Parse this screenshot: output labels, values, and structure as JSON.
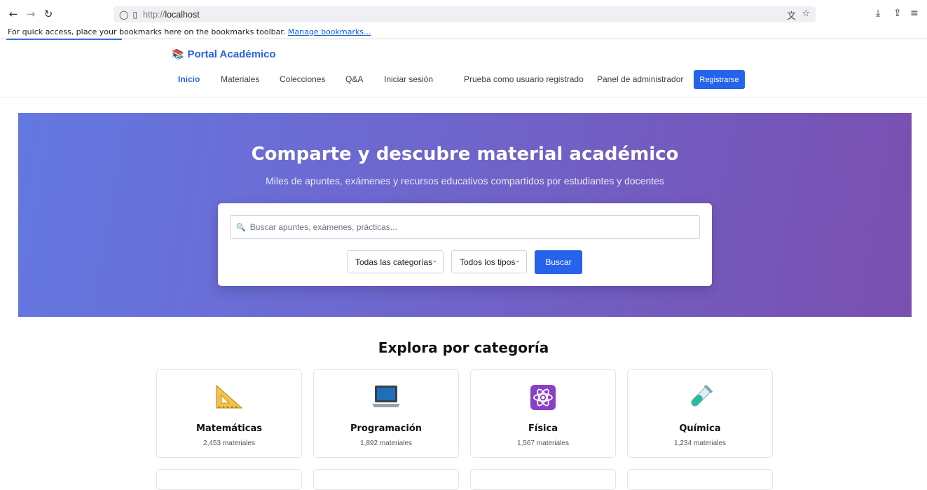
{
  "browser": {
    "url_prefix": "http://",
    "url_host": "localhost",
    "bookmarks_text": "For quick access, place your bookmarks here on the bookmarks toolbar.",
    "bookmarks_link": "Manage bookmarks..."
  },
  "header": {
    "logo_text": "Portal Académico",
    "nav": [
      {
        "label": "Inicio",
        "active": true
      },
      {
        "label": "Materiales"
      },
      {
        "label": "Colecciones"
      },
      {
        "label": "Q&A"
      },
      {
        "label": "Iniciar sesión"
      },
      {
        "label": "Prueba como usuario registrado"
      },
      {
        "label": "Panel de administrador"
      }
    ],
    "register_label": "Registrarse"
  },
  "hero": {
    "title": "Comparte y descubre material académico",
    "subtitle": "Miles de apuntes, exámenes y recursos educativos compartidos por estudiantes y docentes",
    "search_placeholder": "Buscar apuntes, exámenes, prácticas...",
    "category_select": "Todas las categorías",
    "type_select": "Todos los tipos",
    "search_button": "Buscar"
  },
  "categories": {
    "title": "Explora por categoría",
    "items": [
      {
        "name": "Matemáticas",
        "count": "2,453 materiales",
        "icon": "triangular-ruler-icon"
      },
      {
        "name": "Programación",
        "count": "1,892 materiales",
        "icon": "laptop-icon"
      },
      {
        "name": "Física",
        "count": "1,567 materiales",
        "icon": "atom-icon"
      },
      {
        "name": "Química",
        "count": "1,234 materiales",
        "icon": "test-tube-icon"
      }
    ]
  },
  "colors": {
    "accent": "#2563eb",
    "hero_start": "#6478e2",
    "hero_end": "#7a4fb0"
  }
}
